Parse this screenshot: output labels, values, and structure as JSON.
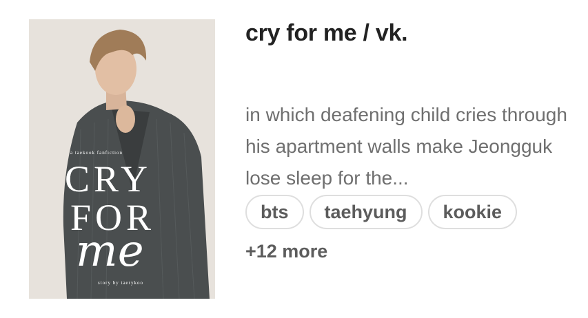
{
  "story": {
    "title": "cry for me / vk.",
    "description": "in which deafening child cries through his apartment walls make Jeongguk lose sleep for the...",
    "tags": [
      "bts",
      "taehyung",
      "kookie"
    ],
    "more_tags": "+12 more"
  },
  "cover": {
    "subtitle": "a taekook fanfiction",
    "title_line1": "CRY",
    "title_line2": "FOR",
    "title_line3": "me",
    "byline": "story by taerykoo"
  }
}
